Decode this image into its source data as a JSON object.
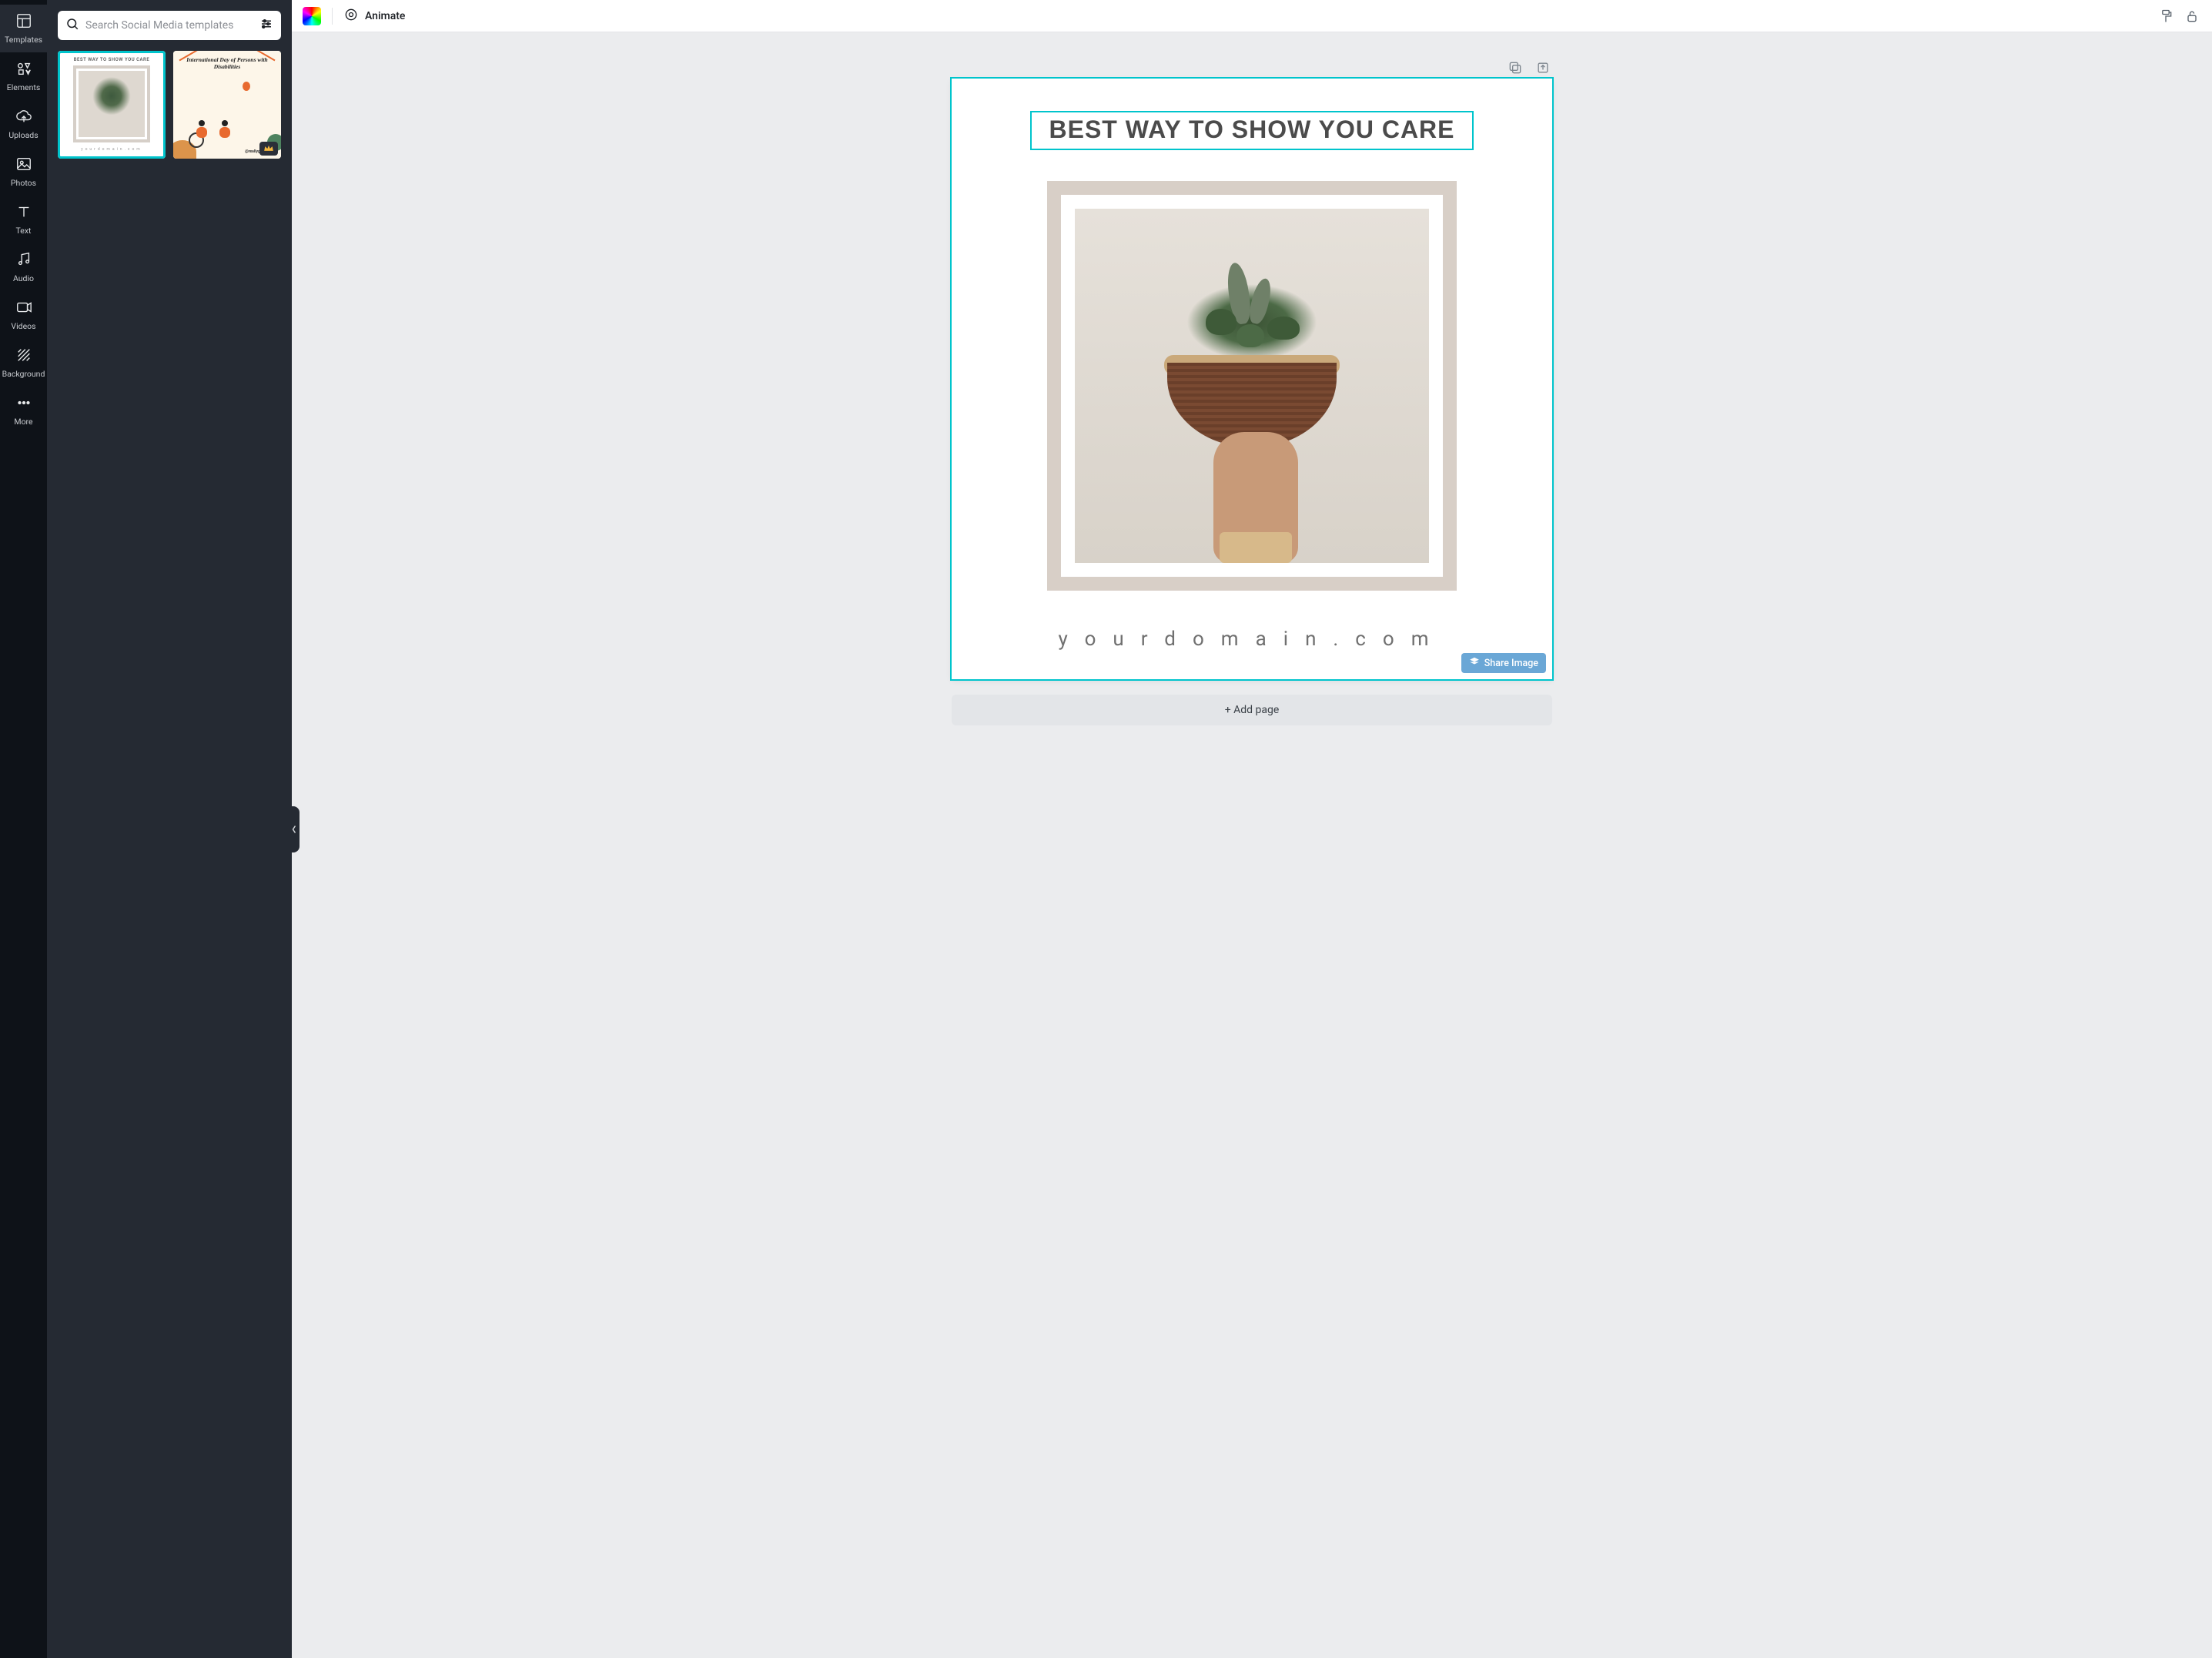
{
  "nav": {
    "items": [
      {
        "label": "Templates"
      },
      {
        "label": "Elements"
      },
      {
        "label": "Uploads"
      },
      {
        "label": "Photos"
      },
      {
        "label": "Text"
      },
      {
        "label": "Audio"
      },
      {
        "label": "Videos"
      },
      {
        "label": "Background"
      },
      {
        "label": "More"
      }
    ]
  },
  "search": {
    "placeholder": "Search Social Media templates"
  },
  "thumbs": {
    "t1_title": "BEST WAY TO SHOW YOU CARE",
    "t1_domain": "yourdomain.com",
    "t2_title": "International Day of Persons with Disabilities",
    "t2_tag": "@reallygreatsite"
  },
  "topbar": {
    "animate_label": "Animate"
  },
  "page": {
    "heading": "BEST WAY TO SHOW YOU CARE",
    "domain": "yourdomain.com",
    "share_label": "Share Image"
  },
  "add_page_label": "+ Add page",
  "colors": {
    "selection": "#00c4cc",
    "share_badge": "#6aa7d6"
  }
}
